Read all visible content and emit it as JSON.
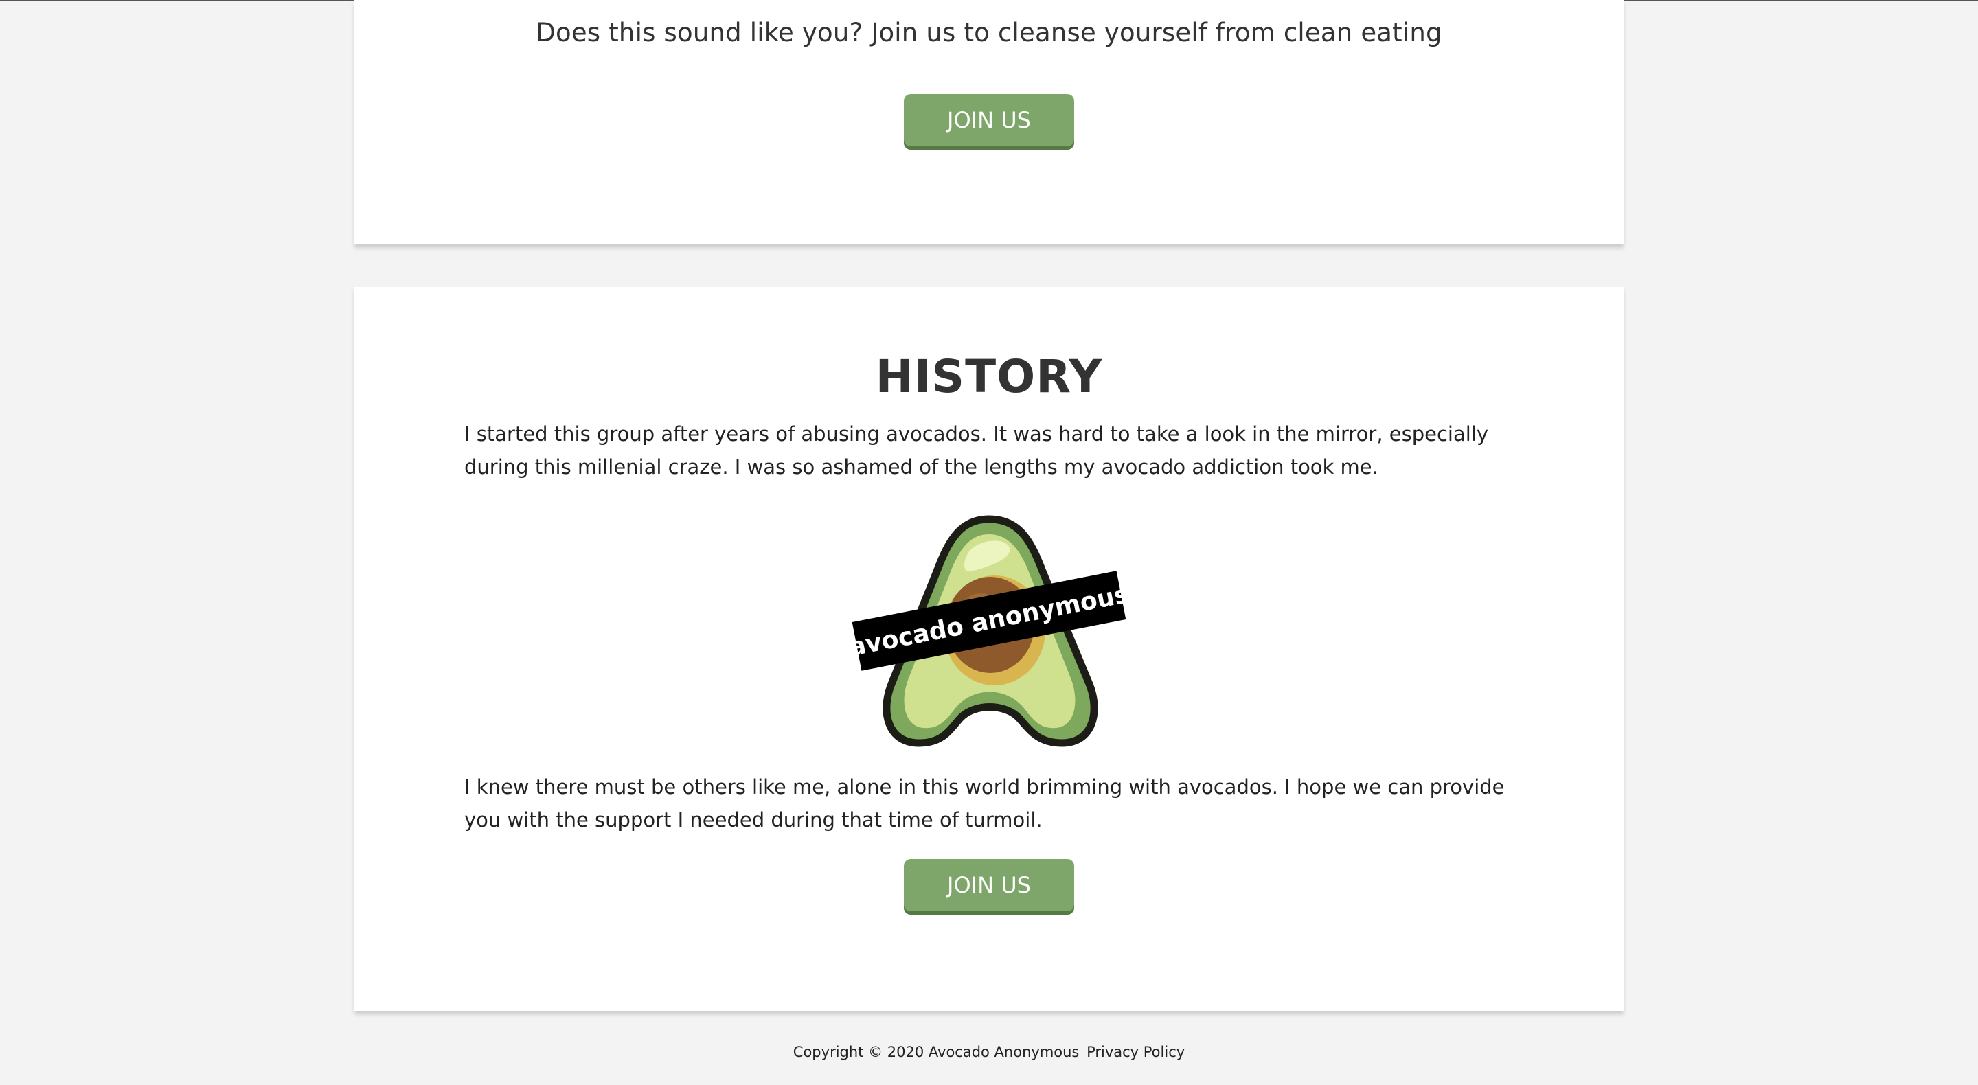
{
  "top_card": {
    "cta_text": "Does this sound like you? Join us to cleanse yourself from clean eating",
    "join_button_label": "JOIN US"
  },
  "history": {
    "title": "HISTORY",
    "paragraph_1": "I started this group after years of abusing avocados. It was hard to take a look in the mirror, especially during this millenial craze. I was so ashamed of the lengths my avocado addiction took me.",
    "logo_banner_text": "avocado anonymous",
    "paragraph_2": "I knew there must be others like me, alone in this world brimming with avocados. I hope we can provide you with the support I needed during that time of turmoil.",
    "join_button_label": "JOIN US"
  },
  "footer": {
    "copyright": "Copyright © 2020 Avocado Anonymous",
    "privacy_link": "Privacy Policy"
  },
  "colors": {
    "page_background": "#f3f3f3",
    "card_background": "#ffffff",
    "button_green": "#7fa66a",
    "text_dark": "#333333"
  },
  "icons": {
    "logo": "avocado-logo-icon"
  }
}
